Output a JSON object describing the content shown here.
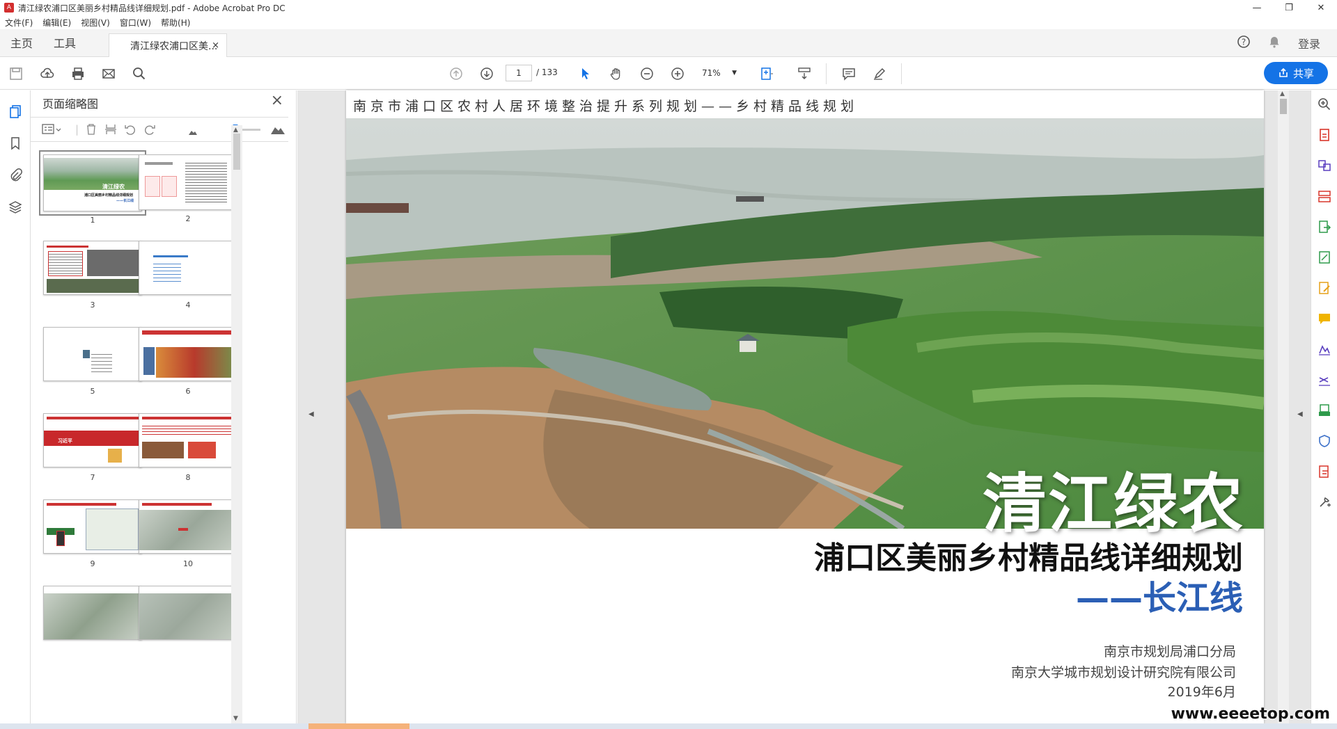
{
  "window": {
    "title": "清江绿农浦口区美丽乡村精品线详细规划.pdf - Adobe Acrobat Pro DC",
    "minimize": "—",
    "maximize": "❐",
    "close": "✕"
  },
  "menu": [
    "文件(F)",
    "编辑(E)",
    "视图(V)",
    "窗口(W)",
    "帮助(H)"
  ],
  "tabs": {
    "home": "主页",
    "tools": "工具",
    "document": "清江绿农浦口区美...",
    "close": "×",
    "login": "登录"
  },
  "toolbar": {
    "page_current": "1",
    "page_total": "/ 133",
    "zoom": "71%",
    "share": "共享"
  },
  "thumb_panel": {
    "title": "页面缩略图",
    "pages": [
      "1",
      "2",
      "3",
      "4",
      "5",
      "6",
      "7",
      "8",
      "9",
      "10"
    ]
  },
  "document": {
    "header": "南京市浦口区农村人居环境整治提升系列规划——乡村精品线规划",
    "title": "清江绿农",
    "subtitle": "浦口区美丽乡村精品线详细规划",
    "subtitle2": "——长江线",
    "org1": "南京市规划局浦口分局",
    "org2": "南京大学城市规划设计研究院有限公司",
    "date": "2019年6月"
  },
  "watermark": "www.eeeetop.com",
  "colors": {
    "accent": "#1473e6",
    "subtitle_blue": "#2b5fb5"
  }
}
